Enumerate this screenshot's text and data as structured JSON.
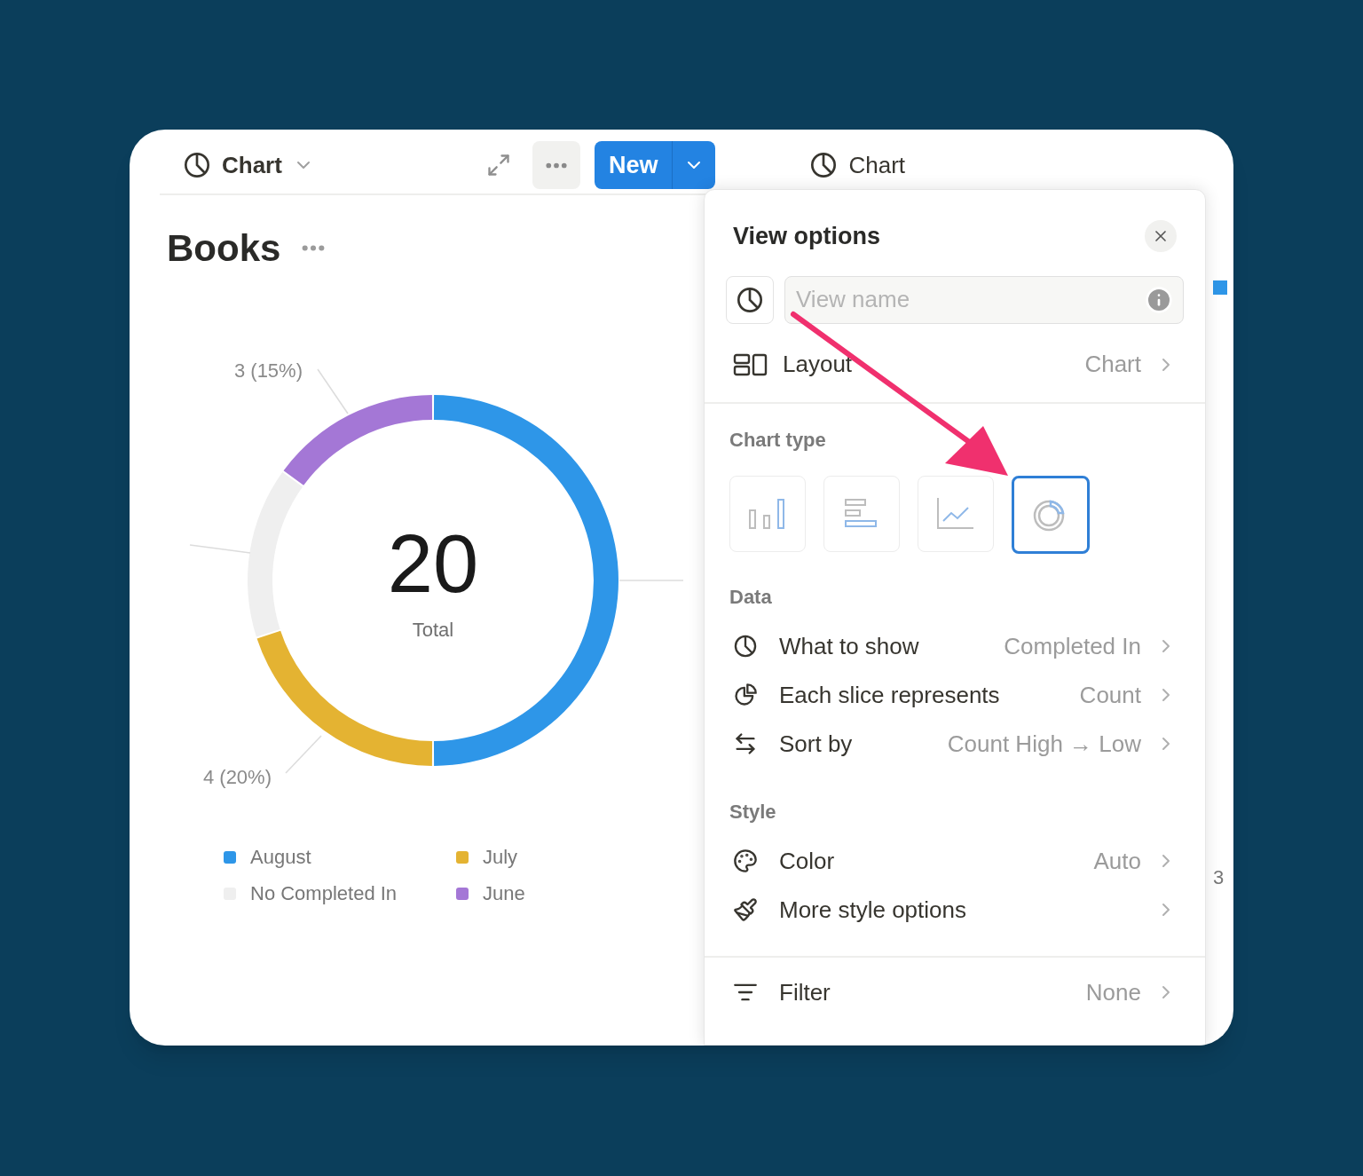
{
  "toolbar": {
    "view_tab": {
      "label": "Chart"
    },
    "new_button": {
      "label": "New"
    }
  },
  "second_view_tab": {
    "label": "Chart"
  },
  "page": {
    "title": "Books"
  },
  "chart_data": {
    "type": "donut",
    "categories": [
      "August",
      "July",
      "No Completed In",
      "June"
    ],
    "series": [
      {
        "values": [
          50,
          20,
          15,
          15
        ]
      }
    ],
    "value_labels": [
      null,
      "4 (20%)",
      null,
      "3 (15%)"
    ]
  },
  "donut_center": {
    "value": "20",
    "label": "Total"
  },
  "legend": [
    {
      "color": "#2e96e8"
    },
    {
      "color": "#e4b332"
    },
    {
      "color": "#efefef"
    },
    {
      "color": "#a477d6"
    }
  ],
  "view_options": {
    "title": "View options",
    "view_name": {
      "placeholder": "View name"
    },
    "layout": {
      "label": "Layout",
      "value": "Chart"
    },
    "chart_type_label": "Chart type",
    "chart_types": [
      {
        "kind": "bar",
        "selected": false
      },
      {
        "kind": "hbar",
        "selected": false
      },
      {
        "kind": "line",
        "selected": false
      },
      {
        "kind": "donut",
        "selected": true
      }
    ],
    "sections": [
      {
        "title": "Data",
        "rows": [
          {
            "kind": "pie",
            "label": "What to show",
            "value": "Completed In"
          },
          {
            "kind": "slice",
            "label": "Each slice represents",
            "value": "Count"
          },
          {
            "kind": "sort",
            "label": "Sort by",
            "value": "Count High → Low"
          }
        ]
      },
      {
        "title": "Style",
        "rows": [
          {
            "kind": "color",
            "label": "Color",
            "value": "Auto"
          },
          {
            "kind": "brush",
            "label": "More style options"
          }
        ]
      },
      {
        "rows": [
          {
            "kind": "filter",
            "label": "Filter",
            "value": "None"
          }
        ]
      }
    ]
  },
  "background_chart": {
    "label": "3"
  }
}
